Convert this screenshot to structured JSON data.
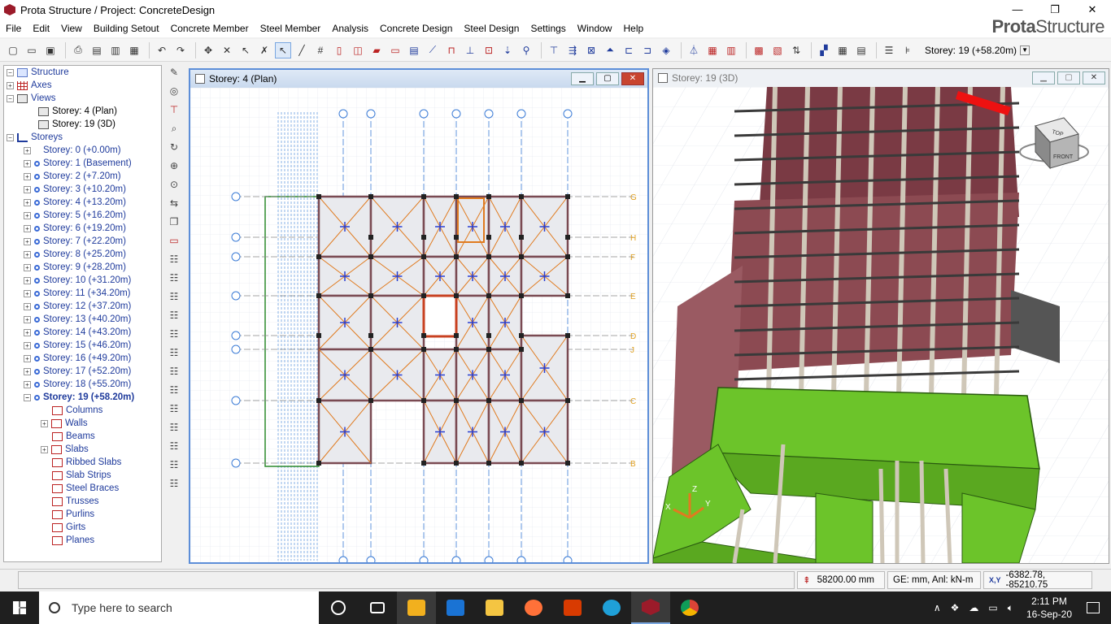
{
  "window": {
    "title": "Prota Structure / Project: ConcreteDesign",
    "minimize": "—",
    "maximize": "❐",
    "close": "✕"
  },
  "brand": {
    "part1": "Prota",
    "part2": "Structure"
  },
  "menu": [
    "File",
    "Edit",
    "View",
    "Building Setout",
    "Concrete Member",
    "Steel Member",
    "Analysis",
    "Concrete Design",
    "Steel Design",
    "Settings",
    "Window",
    "Help"
  ],
  "toolbar": {
    "storey_selector": "Storey: 19 (+58.20m)"
  },
  "tree": {
    "root": "Structure",
    "axes": "Axes",
    "views": "Views",
    "view_items": [
      "Storey: 4 (Plan)",
      "Storey: 19 (3D)"
    ],
    "storeys": "Storeys",
    "storey_items": [
      "Storey: 0 (+0.00m)",
      "Storey: 1 (Basement)",
      "Storey: 2 (+7.20m)",
      "Storey: 3 (+10.20m)",
      "Storey: 4 (+13.20m)",
      "Storey: 5 (+16.20m)",
      "Storey: 6 (+19.20m)",
      "Storey: 7 (+22.20m)",
      "Storey: 8 (+25.20m)",
      "Storey: 9 (+28.20m)",
      "Storey: 10 (+31.20m)",
      "Storey: 11 (+34.20m)",
      "Storey: 12 (+37.20m)",
      "Storey: 13 (+40.20m)",
      "Storey: 14 (+43.20m)",
      "Storey: 15 (+46.20m)",
      "Storey: 16 (+49.20m)",
      "Storey: 17 (+52.20m)",
      "Storey: 18 (+55.20m)"
    ],
    "selected_storey": "Storey: 19 (+58.20m)",
    "members": [
      "Columns",
      "Walls",
      "Beams",
      "Slabs",
      "Ribbed Slabs",
      "Slab Strips",
      "Steel Braces",
      "Trusses",
      "Purlins",
      "Girts",
      "Planes"
    ]
  },
  "plan_window": {
    "title": "Storey: 4 (Plan)",
    "axis_labels": [
      "G",
      "H",
      "F",
      "E",
      "D",
      "J",
      "C",
      "B"
    ]
  },
  "view3d_window": {
    "title": "Storey: 19 (3D)",
    "cube_label": "TOP",
    "cube_front": "FRONT",
    "axis_x": "X",
    "axis_y": "Y",
    "axis_z": "Z"
  },
  "status": {
    "elevation": "58200.00 mm",
    "units": "GE: mm,  Anl: kN-m",
    "coords_label": "X,Y",
    "coords": "-6382.78, -85210.75"
  },
  "taskbar": {
    "search_placeholder": "Type here to search",
    "time": "2:11 PM",
    "date": "16-Sep-20"
  },
  "colors": {
    "accent": "#1f3b9c",
    "slab_outline": "#e07b20",
    "green_wall": "#6cc42a"
  }
}
